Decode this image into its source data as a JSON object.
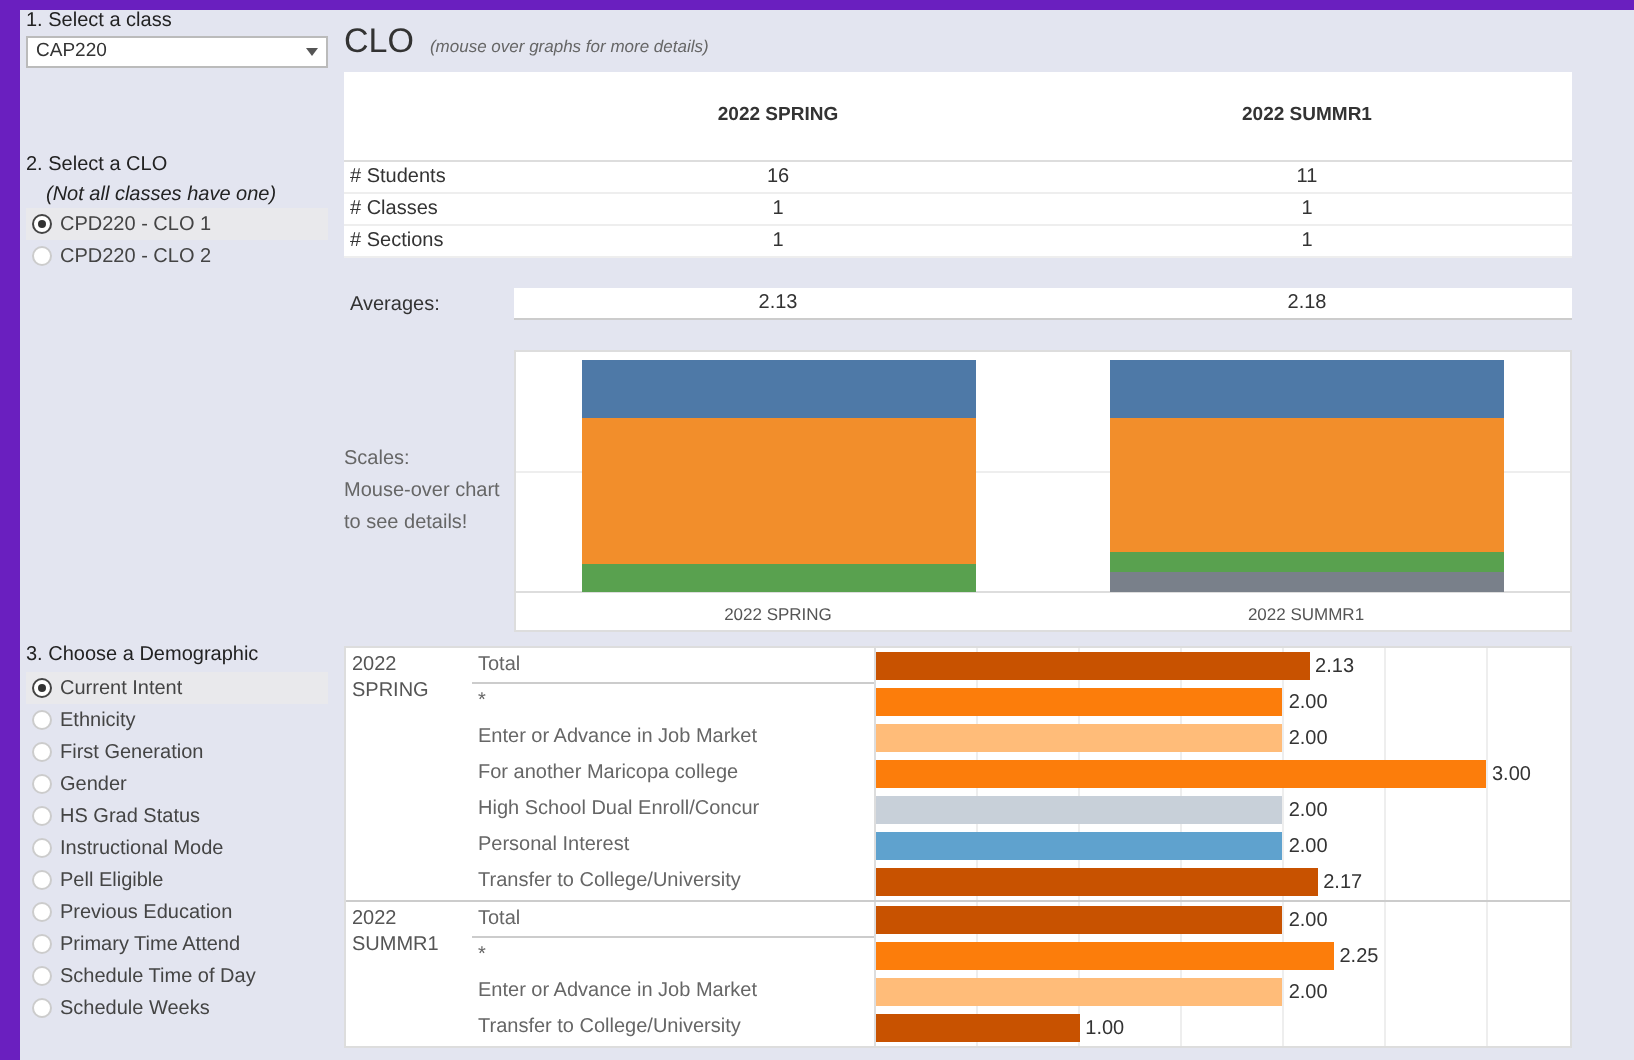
{
  "sidebar": {
    "class_label": "1. Select a class",
    "class_value": "CAP220",
    "clo_label": "2. Select a CLO",
    "clo_note": "(Not all classes have one)",
    "clos": [
      {
        "label": "CPD220 - CLO 1",
        "selected": true
      },
      {
        "label": "CPD220 - CLO 2",
        "selected": false
      }
    ],
    "demo_label": "3. Choose a Demographic",
    "demographics": [
      {
        "label": "Current Intent",
        "selected": true
      },
      {
        "label": "Ethnicity",
        "selected": false
      },
      {
        "label": "First Generation",
        "selected": false
      },
      {
        "label": "Gender",
        "selected": false
      },
      {
        "label": "HS Grad Status",
        "selected": false
      },
      {
        "label": "Instructional Mode",
        "selected": false
      },
      {
        "label": "Pell Eligible",
        "selected": false
      },
      {
        "label": "Previous Education",
        "selected": false
      },
      {
        "label": "Primary Time Attend",
        "selected": false
      },
      {
        "label": "Schedule Time of Day",
        "selected": false
      },
      {
        "label": "Schedule Weeks",
        "selected": false
      }
    ]
  },
  "title": "CLO",
  "subtitle": "(mouse over graphs for more details)",
  "stats": {
    "columns": [
      "2022 SPRING",
      "2022 SUMMR1"
    ],
    "rows": [
      {
        "label": "# Students",
        "values": [
          "16",
          "11"
        ]
      },
      {
        "label": "# Classes",
        "values": [
          "1",
          "1"
        ]
      },
      {
        "label": "# Sections",
        "values": [
          "1",
          "1"
        ]
      }
    ]
  },
  "averages": {
    "label": "Averages:",
    "values": [
      "2.13",
      "2.18"
    ]
  },
  "scales": {
    "label": "Scales:\nMouse-over chart\nto see details!",
    "categories": [
      "2022 SPRING",
      "2022 SUMMR1"
    ]
  },
  "breakdown": [
    {
      "term": "2022\nSPRING",
      "rows": [
        {
          "label": "Total",
          "value": "2.13",
          "color": "#c85200"
        },
        {
          "label": "*",
          "value": "2.00",
          "color": "#fc7d0b"
        },
        {
          "label": "Enter or Advance in Job Market",
          "value": "2.00",
          "color": "#ffbc79"
        },
        {
          "label": "For another Maricopa college",
          "value": "3.00",
          "color": "#fc7d0b"
        },
        {
          "label": "High School Dual Enroll/Concur",
          "value": "2.00",
          "color": "#c8d0d9"
        },
        {
          "label": "Personal Interest",
          "value": "2.00",
          "color": "#5fa2ce"
        },
        {
          "label": "Transfer to College/University",
          "value": "2.17",
          "color": "#c85200"
        }
      ]
    },
    {
      "term": "2022\nSUMMR1",
      "rows": [
        {
          "label": "Total",
          "value": "2.00",
          "color": "#c85200"
        },
        {
          "label": "*",
          "value": "2.25",
          "color": "#fc7d0b"
        },
        {
          "label": "Enter or Advance in Job Market",
          "value": "2.00",
          "color": "#ffbc79"
        },
        {
          "label": "Transfer to College/University",
          "value": "1.00",
          "color": "#c85200"
        }
      ]
    }
  ]
}
